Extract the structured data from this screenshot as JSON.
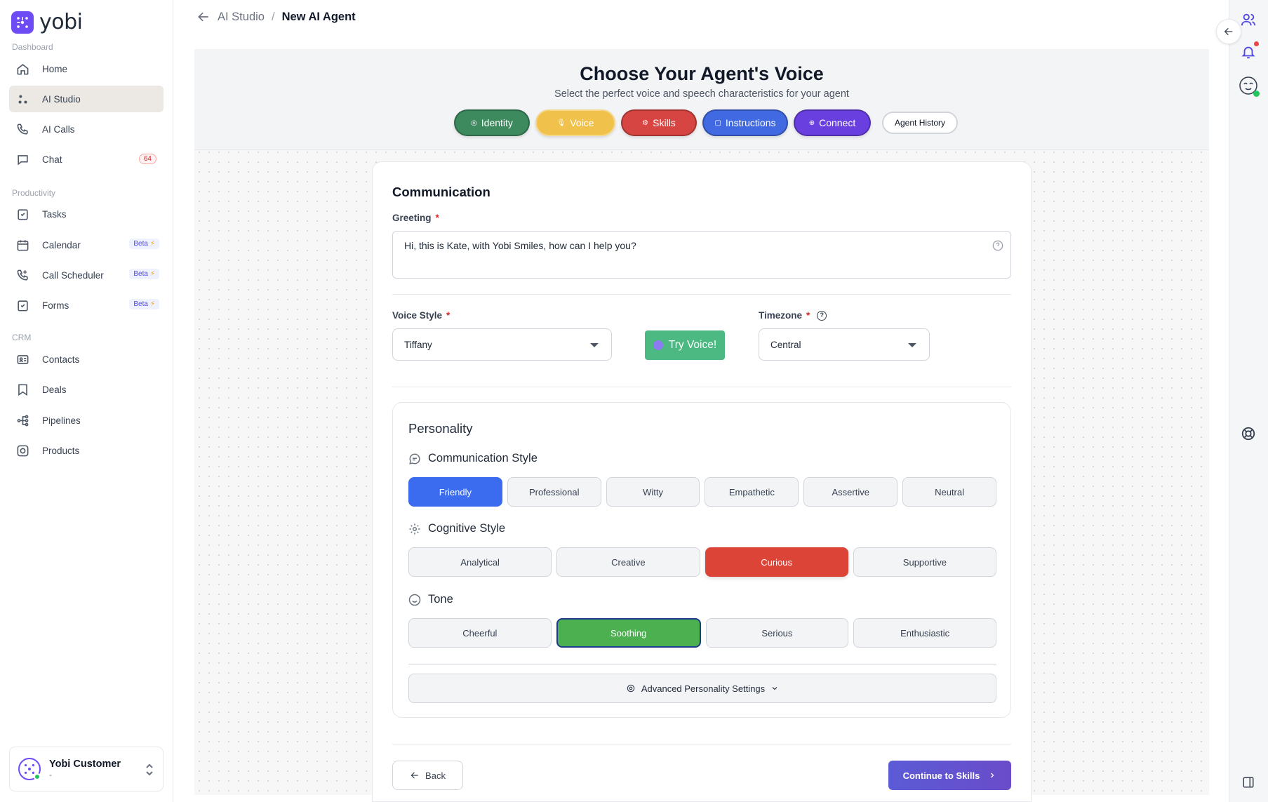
{
  "brand": {
    "name": "yobi",
    "color": "#6d4cf5"
  },
  "sidebar": {
    "sections": [
      {
        "label": "Dashboard",
        "items": [
          {
            "label": "Home",
            "icon": "home-icon"
          },
          {
            "label": "AI Studio",
            "icon": "ai-studio-icon",
            "active": true
          },
          {
            "label": "AI Calls",
            "icon": "phone-icon"
          },
          {
            "label": "Chat",
            "icon": "chat-icon",
            "badge": "64"
          }
        ]
      },
      {
        "label": "Productivity",
        "items": [
          {
            "label": "Tasks",
            "icon": "tasks-icon"
          },
          {
            "label": "Calendar",
            "icon": "calendar-icon",
            "badge": "Beta"
          },
          {
            "label": "Call Scheduler",
            "icon": "call-scheduler-icon",
            "badge": "Beta"
          },
          {
            "label": "Forms",
            "icon": "forms-icon",
            "badge": "Beta"
          }
        ]
      },
      {
        "label": "CRM",
        "items": [
          {
            "label": "Contacts",
            "icon": "contacts-icon"
          },
          {
            "label": "Deals",
            "icon": "deals-icon"
          },
          {
            "label": "Pipelines",
            "icon": "pipelines-icon"
          },
          {
            "label": "Products",
            "icon": "products-icon"
          }
        ]
      }
    ],
    "user": {
      "name": "Yobi Customer",
      "sub": "-"
    }
  },
  "breadcrumb": {
    "parent": "AI Studio",
    "separator": "/",
    "current": "New AI Agent"
  },
  "hero": {
    "title": "Choose Your Agent's Voice",
    "subtitle": "Select the perfect voice and speech characteristics for your agent"
  },
  "steps": [
    {
      "label": "Identity",
      "color": "#3d8a5f"
    },
    {
      "label": "Voice",
      "color": "#f0c14b",
      "active": true
    },
    {
      "label": "Skills",
      "color": "#d64541"
    },
    {
      "label": "Instructions",
      "color": "#4169e1"
    },
    {
      "label": "Connect",
      "color": "#6a3fe0"
    }
  ],
  "agent_history_label": "Agent History",
  "communication": {
    "title": "Communication",
    "greeting_label": "Greeting",
    "required_mark": "*",
    "greeting_value": "Hi, this is Kate, with Yobi Smiles, how can I help you?",
    "voice_style_label": "Voice Style",
    "voice_style_value": "Tiffany",
    "try_voice_label": "Try Voice!",
    "timezone_label": "Timezone",
    "timezone_help": "?",
    "timezone_value": "Central"
  },
  "personality": {
    "title": "Personality",
    "communication_style": {
      "title": "Communication Style",
      "options": [
        "Friendly",
        "Professional",
        "Witty",
        "Empathetic",
        "Assertive",
        "Neutral"
      ],
      "selected": "Friendly"
    },
    "cognitive_style": {
      "title": "Cognitive Style",
      "options": [
        "Analytical",
        "Creative",
        "Curious",
        "Supportive"
      ],
      "selected": "Curious"
    },
    "tone": {
      "title": "Tone",
      "options": [
        "Cheerful",
        "Soothing",
        "Serious",
        "Enthusiastic"
      ],
      "selected": "Soothing"
    },
    "advanced_label": "Advanced Personality Settings"
  },
  "footer": {
    "back_label": "Back",
    "continue_label": "Continue to Skills"
  }
}
